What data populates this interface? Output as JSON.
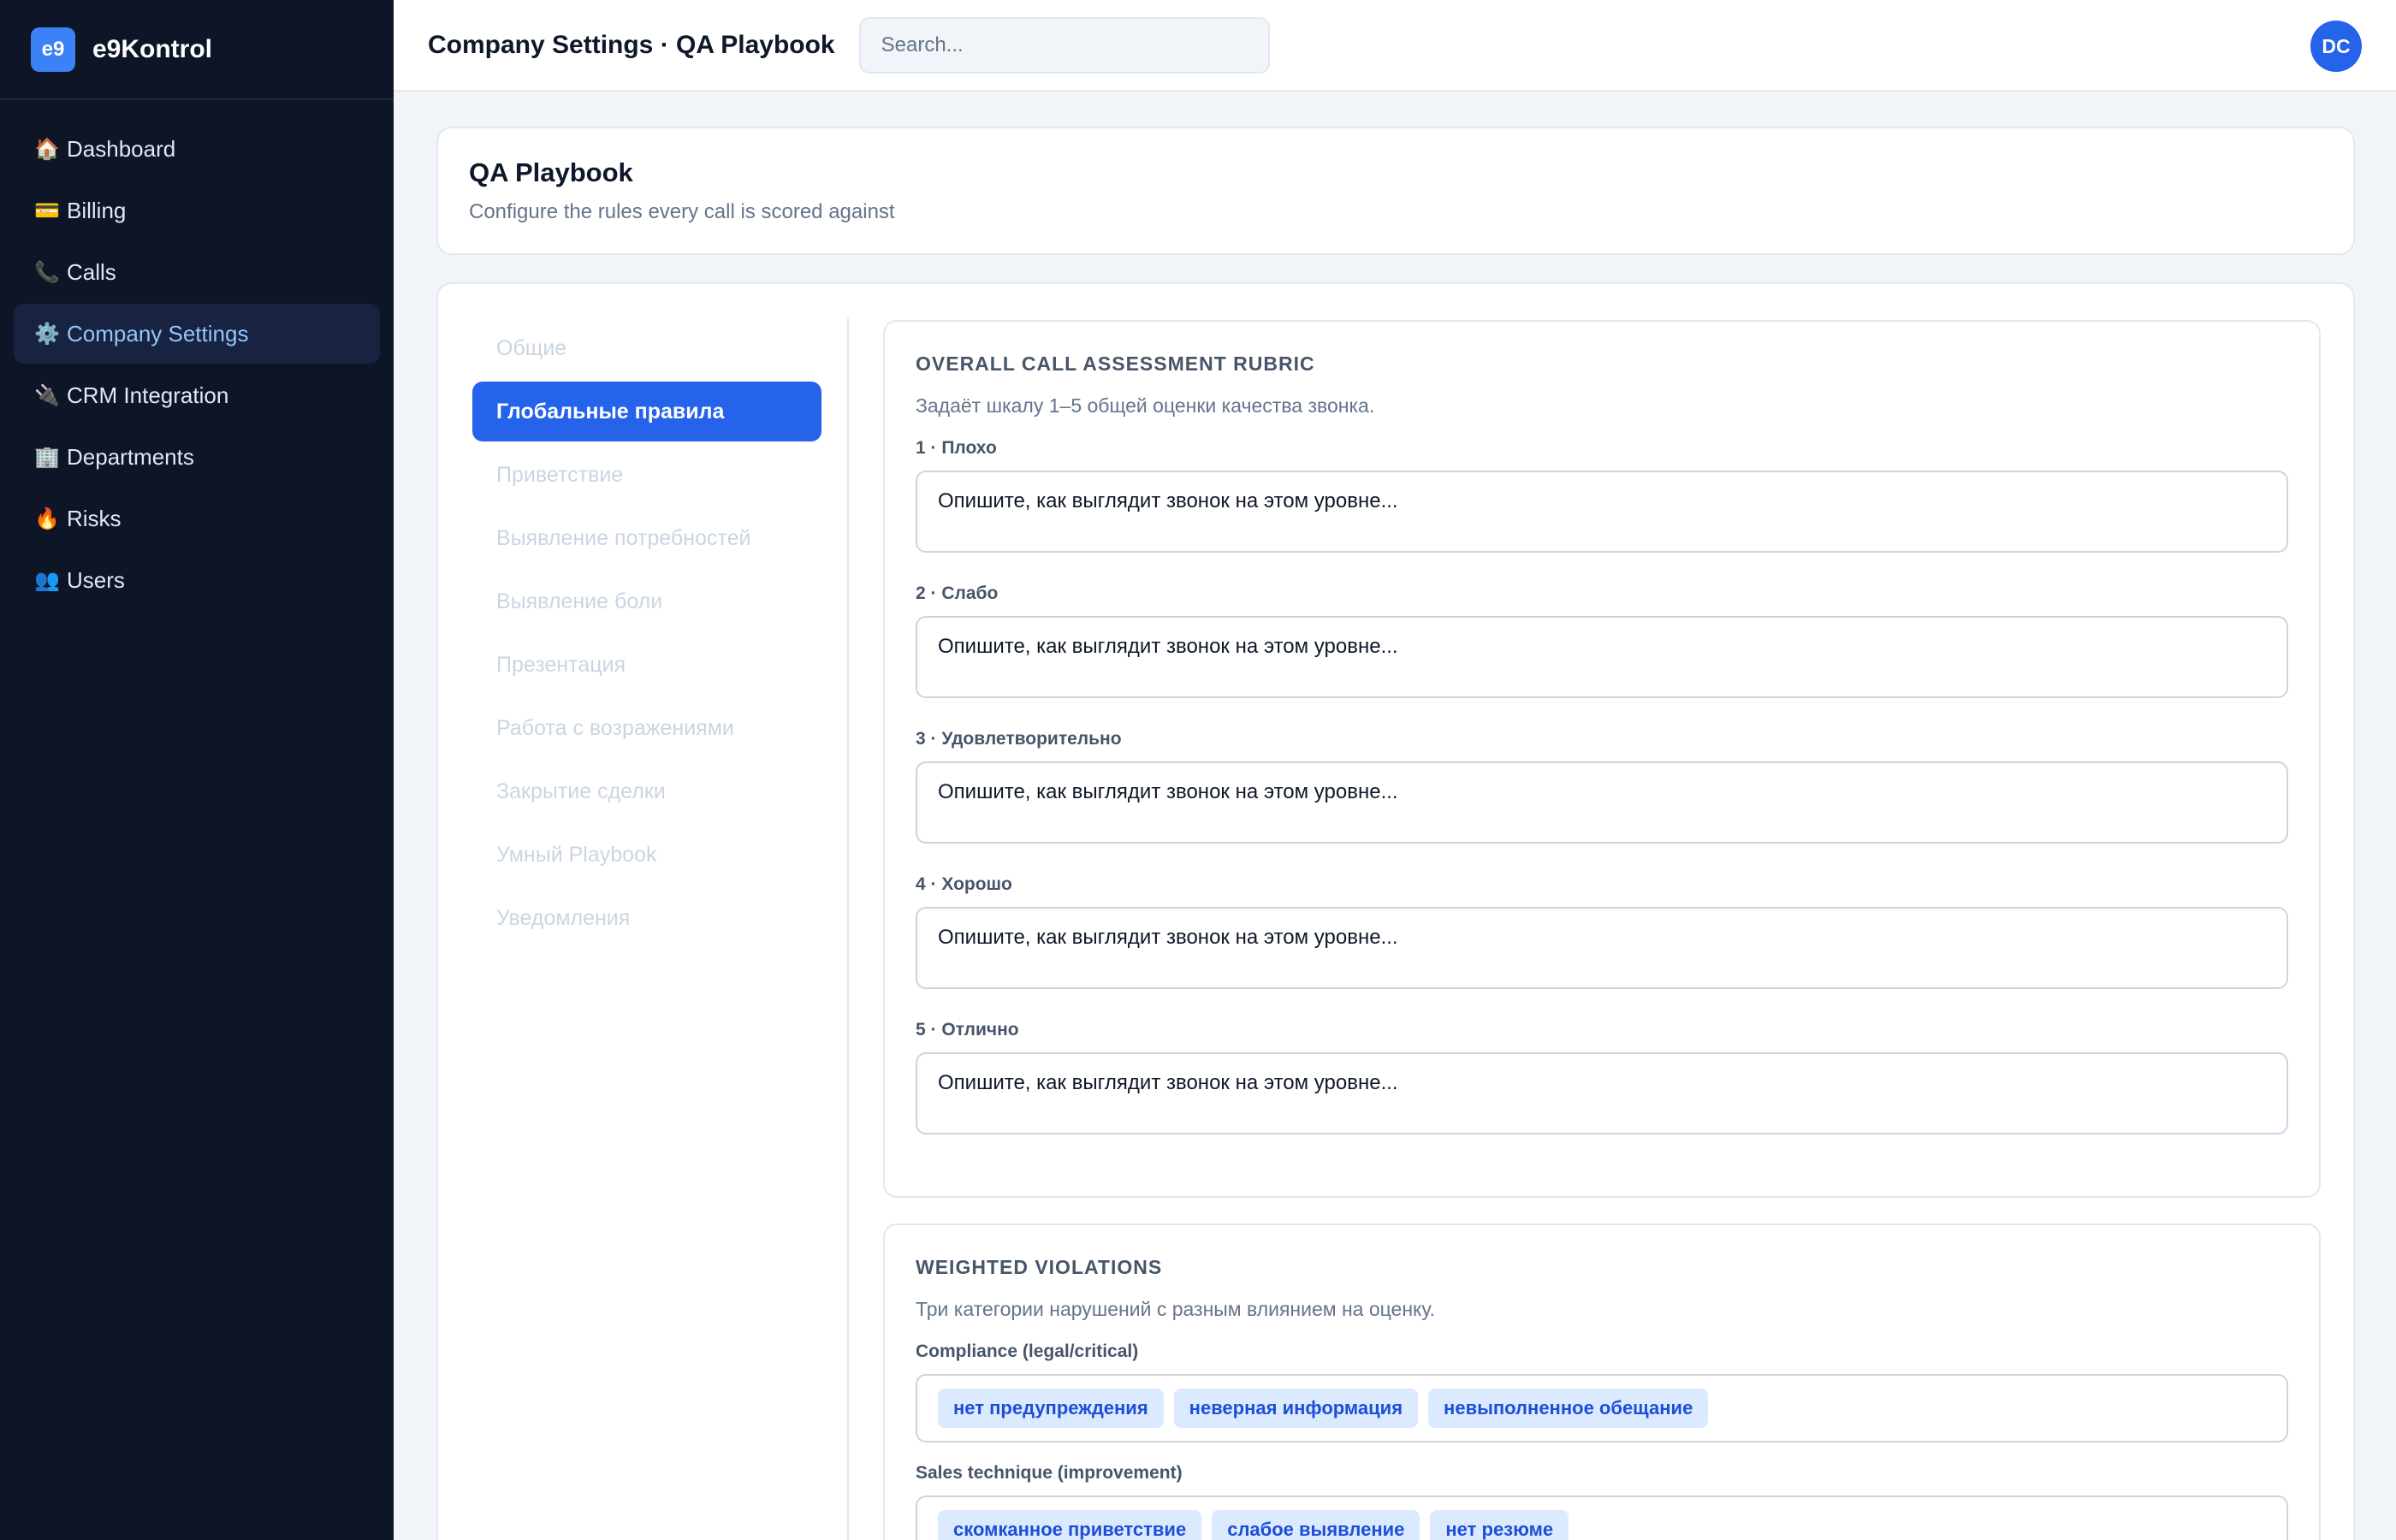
{
  "app": {
    "logo": "e9",
    "name": "e9Kontrol"
  },
  "sidebar": {
    "items": [
      {
        "icon": "🏠",
        "label": "Dashboard"
      },
      {
        "icon": "💳",
        "label": "Billing"
      },
      {
        "icon": "📞",
        "label": "Calls"
      },
      {
        "icon": "⚙️",
        "label": "Company Settings",
        "active": true
      },
      {
        "icon": "🔌",
        "label": "CRM Integration"
      },
      {
        "icon": "🏢",
        "label": "Departments"
      },
      {
        "icon": "🔥",
        "label": "Risks"
      },
      {
        "icon": "👥",
        "label": "Users"
      }
    ]
  },
  "header": {
    "title": "Company Settings · QA Playbook",
    "search_placeholder": "Search...",
    "avatar_initials": "DC"
  },
  "page": {
    "title": "QA Playbook",
    "subtitle": "Configure the rules every call is scored against"
  },
  "tabs": [
    "Общие",
    "Глобальные правила",
    "Приветствие",
    "Выявление потребностей",
    "Выявление боли",
    "Презентация",
    "Работа с возражениями",
    "Закрытие сделки",
    "Умный Playbook",
    "Уведомления"
  ],
  "active_tab": "Глобальные правила",
  "rubric": {
    "title": "OVERALL CALL ASSESSMENT RUBRIC",
    "description": "Задаёт шкалу 1–5 общей оценки качества звонка.",
    "levels": [
      {
        "label": "1 · Плохо",
        "placeholder": "Опишите, как выглядит звонок на этом уровне..."
      },
      {
        "label": "2 · Слабо",
        "placeholder": "Опишите, как выглядит звонок на этом уровне..."
      },
      {
        "label": "3 · Удовлетворительно",
        "placeholder": "Опишите, как выглядит звонок на этом уровне..."
      },
      {
        "label": "4 · Хорошо",
        "placeholder": "Опишите, как выглядит звонок на этом уровне..."
      },
      {
        "label": "5 · Отлично",
        "placeholder": "Опишите, как выглядит звонок на этом уровне..."
      }
    ]
  },
  "violations": {
    "title": "WEIGHTED VIOLATIONS",
    "description": "Три категории нарушений с разным влиянием на оценку.",
    "categories": [
      {
        "label": "Compliance (legal/critical)",
        "tags": [
          "нет предупреждения",
          "неверная информация",
          "невыполненное обещание"
        ]
      },
      {
        "label": "Sales technique (improvement)",
        "tags": [
          "скомканное приветствие",
          "слабое выявление",
          "нет резюме"
        ]
      }
    ]
  },
  "colors": {
    "accent": "#2563eb",
    "sidebar_bg": "#0d1526",
    "tag_bg": "#dbeafe",
    "tag_text": "#1d4ed8"
  }
}
